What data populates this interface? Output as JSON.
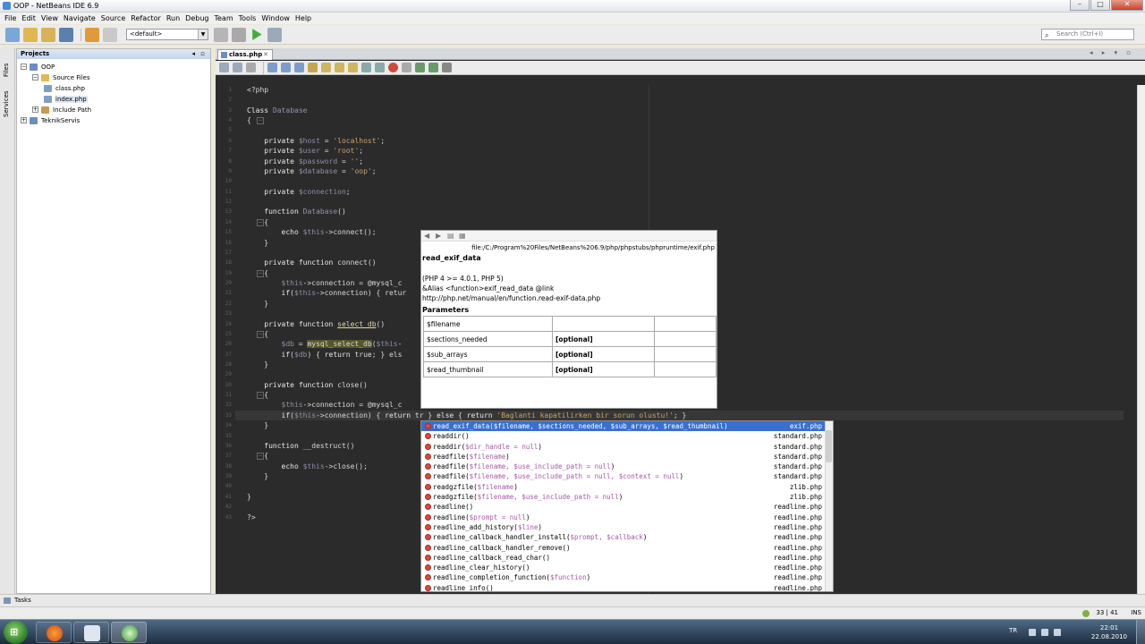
{
  "window": {
    "title": "OOP - NetBeans IDE 6.9",
    "minimize": "–",
    "maximize": "□",
    "close": "✕"
  },
  "menu": [
    "File",
    "Edit",
    "View",
    "Navigate",
    "Source",
    "Refactor",
    "Run",
    "Debug",
    "Team",
    "Tools",
    "Window",
    "Help"
  ],
  "toolbar": {
    "config_value": "<default>",
    "search_placeholder": "Search (Ctrl+I)"
  },
  "side_tabs": [
    "Files",
    "Services"
  ],
  "projects": {
    "title": "Projects",
    "tree": [
      {
        "label": "OOP",
        "expander": "−"
      },
      {
        "label": "Source Files",
        "expander": "−"
      },
      {
        "label": "class.php"
      },
      {
        "label": "index.php"
      },
      {
        "label": "Include Path",
        "expander": "+"
      },
      {
        "label": "TeknikServis",
        "expander": "+"
      }
    ]
  },
  "editor": {
    "tab": "class.php",
    "lines": [
      {
        "n": 1,
        "text": "<?php"
      },
      {
        "n": 2,
        "text": ""
      },
      {
        "n": 3,
        "text": "Class Database"
      },
      {
        "n": 4,
        "text": "{"
      },
      {
        "n": 5,
        "text": ""
      },
      {
        "n": 6,
        "text": "    private $host = 'localhost';"
      },
      {
        "n": 7,
        "text": "    private $user = 'root';"
      },
      {
        "n": 8,
        "text": "    private $password = '';"
      },
      {
        "n": 9,
        "text": "    private $database = 'oop';"
      },
      {
        "n": 10,
        "text": ""
      },
      {
        "n": 11,
        "text": "    private $connection;"
      },
      {
        "n": 12,
        "text": ""
      },
      {
        "n": 13,
        "text": "    function Database()"
      },
      {
        "n": 14,
        "text": "    {"
      },
      {
        "n": 15,
        "text": "        echo $this->connect();"
      },
      {
        "n": 16,
        "text": "    }"
      },
      {
        "n": 17,
        "text": ""
      },
      {
        "n": 18,
        "text": "    private function connect()"
      },
      {
        "n": 19,
        "text": "    {"
      },
      {
        "n": 20,
        "text": "        $this->connection = @mysql_c"
      },
      {
        "n": 21,
        "text": "        if($this->connection) { retur"
      },
      {
        "n": 22,
        "text": "    }"
      },
      {
        "n": 23,
        "text": ""
      },
      {
        "n": 24,
        "text": "    private function select_db()"
      },
      {
        "n": 25,
        "text": "    {"
      },
      {
        "n": 26,
        "text": "        $db = mysql_select_db($this-"
      },
      {
        "n": 27,
        "text": "        if($db) { return true; } els"
      },
      {
        "n": 28,
        "text": "    }"
      },
      {
        "n": 29,
        "text": ""
      },
      {
        "n": 30,
        "text": "    private function close()"
      },
      {
        "n": 31,
        "text": "    {"
      },
      {
        "n": 32,
        "text": "        $this->connection = @mysql_c"
      },
      {
        "n": 33,
        "text": "        if($this->connection) { return tr } else { return 'Baglanti kapatilirken bir sorun olustu!'; }"
      },
      {
        "n": 34,
        "text": "    }"
      },
      {
        "n": 35,
        "text": ""
      },
      {
        "n": 36,
        "text": "    function __destruct()"
      },
      {
        "n": 37,
        "text": "    {"
      },
      {
        "n": 38,
        "text": "        echo $this->close();"
      },
      {
        "n": 39,
        "text": "    }"
      },
      {
        "n": 40,
        "text": ""
      },
      {
        "n": 41,
        "text": "}"
      },
      {
        "n": 42,
        "text": ""
      },
      {
        "n": 43,
        "text": "?>"
      }
    ]
  },
  "doc_popup": {
    "path": "file:/C:/Program%20Files/NetBeans%206.9/php/phpstubs/phpruntime/exif.php",
    "name": "read_exif_data",
    "meta": [
      "(PHP 4 >= 4.0.1, PHP 5)",
      "&Alias <function>exif_read_data @link",
      "http://php.net/manual/en/function.read-exif-data.php"
    ],
    "params_heading": "Parameters",
    "params": [
      {
        "name": "$filename",
        "opt": ""
      },
      {
        "name": "$sections_needed",
        "opt": "[optional]"
      },
      {
        "name": "$sub_arrays",
        "opt": "[optional]"
      },
      {
        "name": "$read_thumbnail",
        "opt": "[optional]"
      }
    ]
  },
  "completion": [
    {
      "fn": "read_exif_data(",
      "params": "$filename, $sections_needed, $sub_arrays, $read_thumbnail",
      "close": ")",
      "src": "exif.php"
    },
    {
      "fn": "readdir(",
      "params": "",
      "close": ")",
      "src": "standard.php"
    },
    {
      "fn": "readdir(",
      "params": "$dir_handle = null",
      "close": ")",
      "src": "standard.php"
    },
    {
      "fn": "readfile(",
      "params": "$filename",
      "close": ")",
      "src": "standard.php"
    },
    {
      "fn": "readfile(",
      "params": "$filename, $use_include_path = null",
      "close": ")",
      "src": "standard.php"
    },
    {
      "fn": "readfile(",
      "params": "$filename, $use_include_path = null, $context = null",
      "close": ")",
      "src": "standard.php"
    },
    {
      "fn": "readgzfile(",
      "params": "$filename",
      "close": ")",
      "src": "zlib.php"
    },
    {
      "fn": "readgzfile(",
      "params": "$filename, $use_include_path = null",
      "close": ")",
      "src": "zlib.php"
    },
    {
      "fn": "readline(",
      "params": "",
      "close": ")",
      "src": "readline.php"
    },
    {
      "fn": "readline(",
      "params": "$prompt = null",
      "close": ")",
      "src": "readline.php"
    },
    {
      "fn": "readline_add_history(",
      "params": "$line",
      "close": ")",
      "src": "readline.php"
    },
    {
      "fn": "readline_callback_handler_install(",
      "params": "$prompt, $callback",
      "close": ")",
      "src": "readline.php"
    },
    {
      "fn": "readline_callback_handler_remove(",
      "params": "",
      "close": ")",
      "src": "readline.php"
    },
    {
      "fn": "readline_callback_read_char(",
      "params": "",
      "close": ")",
      "src": "readline.php"
    },
    {
      "fn": "readline_clear_history(",
      "params": "",
      "close": ")",
      "src": "readline.php"
    },
    {
      "fn": "readline_completion_function(",
      "params": "$function",
      "close": ")",
      "src": "readline.php"
    },
    {
      "fn": "readline_info(",
      "params": "",
      "close": ")",
      "src": "readline.php"
    }
  ],
  "tasks_label": "Tasks",
  "status": {
    "position": "33 | 41",
    "mode": "INS"
  },
  "tray": {
    "lang": "TR",
    "time": "22:01",
    "date": "22.08.2010"
  },
  "icons": {
    "title": "netbeans-icon",
    "start": "windows-start-icon"
  }
}
